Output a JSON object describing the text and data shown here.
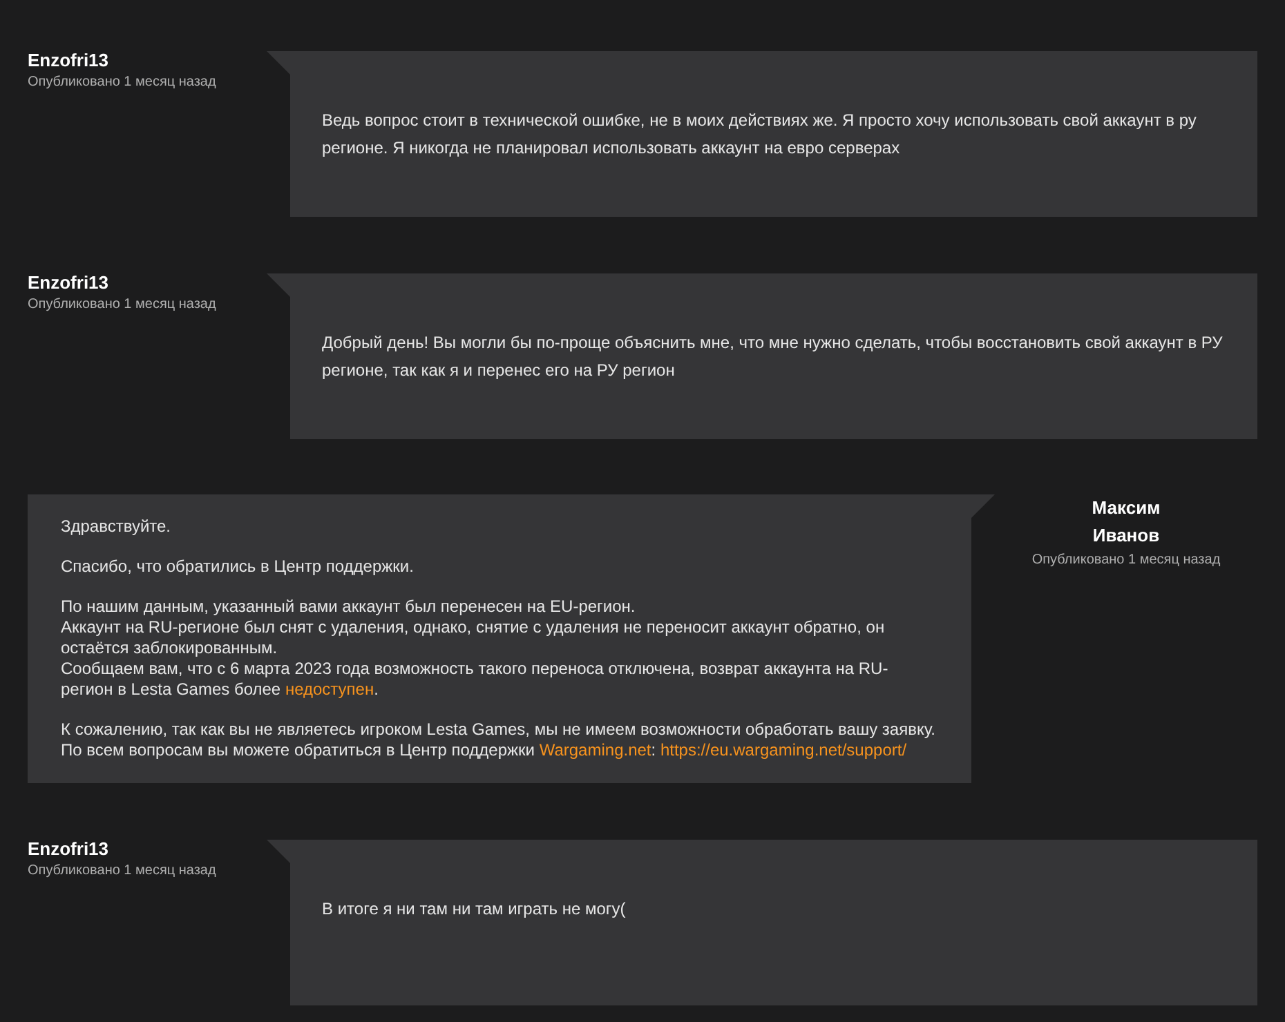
{
  "messages": [
    {
      "kind": "user",
      "author": "Enzofri13",
      "meta": "Опубликовано 1 месяц назад",
      "paragraphs": [
        [
          [
            {
              "text": "Ведь вопрос стоит в технической ошибке, не в моих действиях же. Я просто хочу использовать свой аккаунт в ру регионе. Я никогда не планировал использовать аккаунт на евро серверах",
              "link": false
            }
          ]
        ]
      ]
    },
    {
      "kind": "user",
      "author": "Enzofri13",
      "meta": "Опубликовано 1 месяц назад",
      "paragraphs": [
        [
          [
            {
              "text": "Добрый день! Вы могли бы по-проще объяснить мне, что мне нужно сделать, чтобы восстановить свой аккаунт в РУ регионе, так как я и перенес его на РУ регион",
              "link": false
            }
          ]
        ]
      ]
    },
    {
      "kind": "support",
      "author": "Максим Иванов",
      "meta": "Опубликовано 1 месяц назад",
      "paragraphs": [
        [
          [
            {
              "text": "Здравствуйте.",
              "link": false
            }
          ]
        ],
        [
          [
            {
              "text": "Спасибо, что обратились в Центр поддержки.",
              "link": false
            }
          ]
        ],
        [
          [
            {
              "text": "По нашим данным, указанный вами аккаунт был перенесен на EU-регион.",
              "link": false
            }
          ],
          [
            {
              "text": "Аккаунт на RU-регионе был снят с удаления, однако, снятие с удаления не переносит аккаунт обратно, он остаётся заблокированным.",
              "link": false
            }
          ],
          [
            {
              "text": "Сообщаем вам, что с 6 марта 2023 года возможность такого переноса отключена, возврат аккаунта на RU-регион в Lesta Games более ",
              "link": false
            },
            {
              "text": "недоступен",
              "link": true
            },
            {
              "text": ".",
              "link": false
            }
          ]
        ],
        [
          [
            {
              "text": "К сожалению, так как вы не являетесь игроком Lesta Games, мы не имеем возможности обработать вашу заявку.",
              "link": false
            }
          ],
          [
            {
              "text": "По всем вопросам вы можете обратиться в Центр поддержки ",
              "link": false
            },
            {
              "text": "Wargaming.net",
              "link": true
            },
            {
              "text": ": ",
              "link": false
            },
            {
              "text": "https://eu.wargaming.net/support/",
              "link": true
            }
          ]
        ]
      ]
    },
    {
      "kind": "user",
      "author": "Enzofri13",
      "meta": "Опубликовано 1 месяц назад",
      "paragraphs": [
        [
          [
            {
              "text": "В итоге я ни там ни там играть не могу(",
              "link": false
            }
          ]
        ]
      ]
    }
  ]
}
